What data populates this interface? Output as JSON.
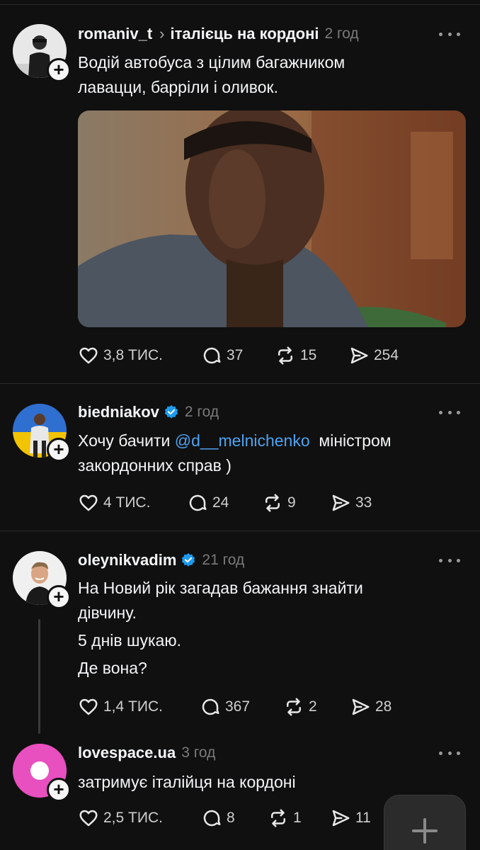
{
  "posts": [
    {
      "username": "romaniv_t",
      "topic": "італієць на кордоні",
      "time": "2 год",
      "text": [
        "Водій автобуса з цілим багажником",
        "лавацци, барріли і оливок."
      ],
      "likes": "3,8 ТИС.",
      "replies": "37",
      "reposts": "15",
      "shares": "254"
    },
    {
      "username": "biedniakov",
      "verified": true,
      "time": "2 год",
      "text_before": "Хочу бачити ",
      "mention": "@d__melnichenko",
      "text_after": "  міністром",
      "text_line2": "закордонних справ )",
      "likes": "4 ТИС.",
      "replies": "24",
      "reposts": "9",
      "shares": "33"
    },
    {
      "username": "oleynikvadim",
      "verified": true,
      "time": "21 год",
      "text": [
        "На Новий рік загадав бажання знайти",
        "дівчину.",
        "5 днів шукаю.",
        "Де вона?"
      ],
      "likes": "1,4 ТИС.",
      "replies": "367",
      "reposts": "2",
      "shares": "28"
    },
    {
      "username": "lovespace.ua",
      "time": "3 год",
      "text": [
        "затримує італійця на кордоні"
      ],
      "likes": "2,5 ТИС.",
      "replies": "8",
      "reposts": "1",
      "shares": "11"
    }
  ],
  "colors": {
    "background": "#101010",
    "mention": "#4ea3f1",
    "verified": "#1d9bf0",
    "lovespace_avatar": "#e84fbf"
  },
  "icons": [
    "heart-icon",
    "reply-icon",
    "repost-icon",
    "share-icon",
    "more-icon",
    "follow-plus-icon",
    "compose-plus-icon",
    "verified-icon"
  ]
}
